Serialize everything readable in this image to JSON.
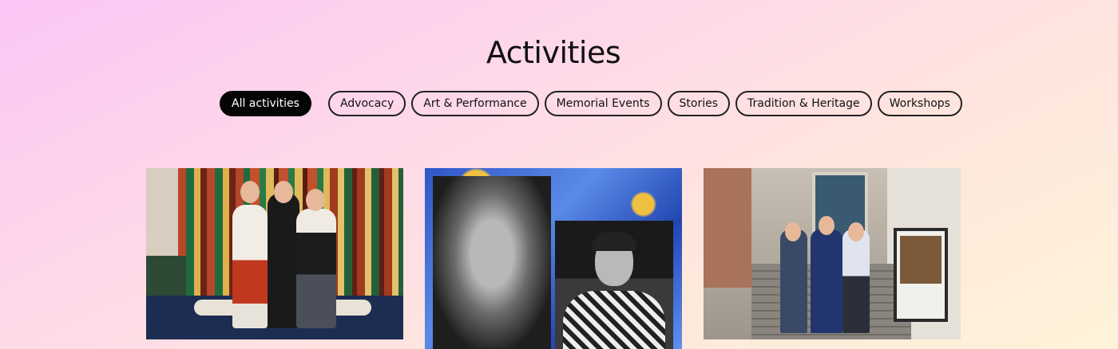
{
  "page": {
    "title": "Activities"
  },
  "filters": [
    {
      "label": "All activities",
      "active": true
    },
    {
      "label": "Advocacy",
      "active": false
    },
    {
      "label": "Art & Performance",
      "active": false
    },
    {
      "label": "Memorial Events",
      "active": false
    },
    {
      "label": "Stories",
      "active": false
    },
    {
      "label": "Tradition & Heritage",
      "active": false
    },
    {
      "label": "Workshops",
      "active": false
    }
  ],
  "cards": [
    {
      "image": "people in traditional costumes photo"
    },
    {
      "image": "black-and-white portraits on blue marble photo"
    },
    {
      "image": "group in front of building photo"
    }
  ],
  "colors": {
    "active_chip_bg": "#050505",
    "chip_border": "#222222"
  }
}
